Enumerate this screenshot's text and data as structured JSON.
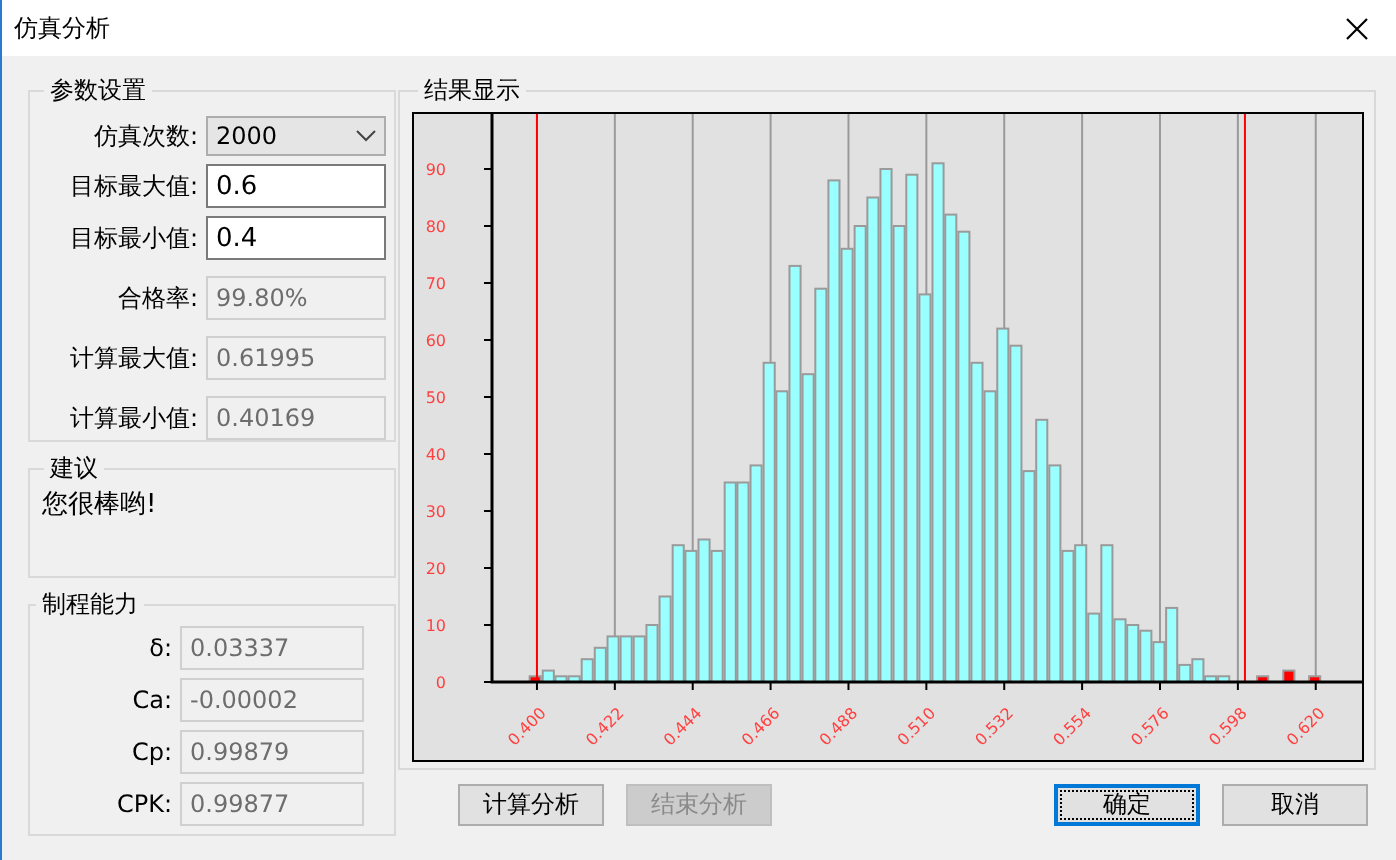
{
  "window": {
    "title": "仿真分析"
  },
  "params": {
    "title": "参数设置",
    "fields": [
      {
        "kind": "dropdown",
        "label": "仿真次数:",
        "value": "2000"
      },
      {
        "kind": "input",
        "label": "目标最大值:",
        "value": "0.6"
      },
      {
        "kind": "input",
        "label": "目标最小值:",
        "value": "0.4"
      },
      {
        "kind": "readonly",
        "label": "合格率:",
        "value": "99.80%"
      },
      {
        "kind": "readonly",
        "label": "计算最大值:",
        "value": "0.61995"
      },
      {
        "kind": "readonly",
        "label": "计算最小值:",
        "value": "0.40169"
      }
    ]
  },
  "advice": {
    "title": "建议",
    "text": "您很棒哟!"
  },
  "capability": {
    "title": "制程能力",
    "fields": [
      {
        "label": "δ:",
        "value": "0.03337"
      },
      {
        "label": "Ca:",
        "value": "-0.00002"
      },
      {
        "label": "Cp:",
        "value": "0.99879"
      },
      {
        "label": "CPK:",
        "value": "0.99877"
      }
    ]
  },
  "results": {
    "title": "结果显示",
    "chart_data": {
      "type": "bar",
      "x": [
        0.3995,
        0.4032,
        0.4068,
        0.4105,
        0.4142,
        0.4179,
        0.4215,
        0.4252,
        0.4289,
        0.4325,
        0.4362,
        0.4399,
        0.4435,
        0.4472,
        0.4509,
        0.4546,
        0.4582,
        0.4619,
        0.4656,
        0.4692,
        0.4729,
        0.4766,
        0.4802,
        0.4839,
        0.4876,
        0.4913,
        0.4949,
        0.4986,
        0.5023,
        0.5059,
        0.5096,
        0.5133,
        0.5169,
        0.5206,
        0.5243,
        0.528,
        0.5316,
        0.5353,
        0.539,
        0.5426,
        0.5463,
        0.55,
        0.5536,
        0.5573,
        0.561,
        0.5647,
        0.5683,
        0.572,
        0.5757,
        0.5793,
        0.583,
        0.5867,
        0.5903,
        0.594,
        0.5977,
        0.6014,
        0.605,
        0.6087,
        0.6124,
        0.616,
        0.6197
      ],
      "series": [
        {
          "color": "#99ffff",
          "values": [
            null,
            2,
            1,
            1,
            4,
            6,
            8,
            8,
            8,
            10,
            15,
            24,
            23,
            25,
            23,
            35,
            35,
            38,
            56,
            51,
            73,
            54,
            69,
            88,
            76,
            80,
            85,
            90,
            80,
            89,
            68,
            91,
            82,
            79,
            56,
            51,
            62,
            59,
            37,
            46,
            38,
            23,
            24,
            12,
            24,
            11,
            10,
            9,
            7,
            13,
            3,
            4,
            1,
            1,
            0,
            0,
            null,
            null,
            null,
            null,
            null
          ]
        },
        {
          "color": "#ff0000",
          "values": [
            1,
            null,
            null,
            null,
            null,
            null,
            null,
            null,
            null,
            null,
            null,
            null,
            null,
            null,
            null,
            null,
            null,
            null,
            null,
            null,
            null,
            null,
            null,
            null,
            null,
            null,
            null,
            null,
            null,
            null,
            null,
            null,
            null,
            null,
            null,
            null,
            null,
            null,
            null,
            null,
            null,
            null,
            null,
            null,
            null,
            null,
            null,
            null,
            null,
            null,
            null,
            null,
            null,
            null,
            null,
            null,
            1,
            0,
            2,
            0,
            1
          ]
        }
      ],
      "xlim": [
        0.3873,
        0.6325
      ],
      "ylim": [
        0,
        100
      ],
      "xticks": [
        {
          "value": 0.4,
          "label": "0.400"
        },
        {
          "value": 0.422,
          "label": "0.422"
        },
        {
          "value": 0.444,
          "label": "0.444"
        },
        {
          "value": 0.466,
          "label": "0.466"
        },
        {
          "value": 0.488,
          "label": "0.488"
        },
        {
          "value": 0.51,
          "label": "0.510"
        },
        {
          "value": 0.532,
          "label": "0.532"
        },
        {
          "value": 0.554,
          "label": "0.554"
        },
        {
          "value": 0.576,
          "label": "0.576"
        },
        {
          "value": 0.598,
          "label": "0.598"
        },
        {
          "value": 0.62,
          "label": "0.620"
        }
      ],
      "yticks": [
        0,
        10,
        20,
        30,
        40,
        50,
        60,
        70,
        80,
        90
      ],
      "grid": true,
      "ref_lines": [
        {
          "axis": "x",
          "value": 0.4,
          "color": "#ff0000"
        },
        {
          "axis": "x",
          "value": 0.6,
          "color": "#ff0000"
        }
      ]
    }
  },
  "actions": [
    {
      "label": "计算分析",
      "disabled": false
    },
    {
      "label": "结束分析",
      "disabled": true
    }
  ],
  "dialog_buttons": [
    {
      "label": "确定",
      "default": true
    },
    {
      "label": "取消",
      "default": false
    }
  ]
}
